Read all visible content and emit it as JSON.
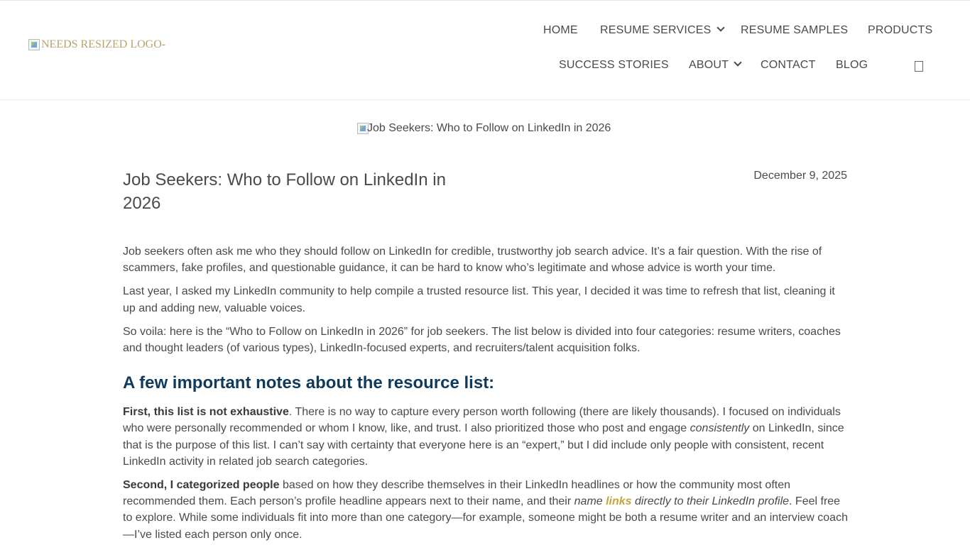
{
  "header": {
    "logo_alt": "NEEDS RESIZED LOGO-",
    "nav": {
      "home": "HOME",
      "resume_services": "RESUME SERVICES",
      "resume_samples": "RESUME SAMPLES",
      "products": "PRODUCTS",
      "success_stories": "SUCCESS STORIES",
      "about": "ABOUT",
      "contact": "CONTACT",
      "blog": "BLOG"
    },
    "icons": {
      "resume_services_dropdown": "chevron-down-icon",
      "about_dropdown": "chevron-down-icon",
      "cart": "cart-icon"
    }
  },
  "hero": {
    "image_alt": "Job Seekers: Who to Follow on LinkedIn in 2026"
  },
  "article": {
    "title": "Job Seekers: Who to Follow on LinkedIn in 2026",
    "date": "December 9, 2025",
    "p1": "Job seekers often ask me who they should follow on LinkedIn for credible, trustworthy job search advice. It’s a fair question. With the rise of scammers, fake profiles, and questionable guidance, it can be hard to know who’s legitimate and whose advice is worth your time.",
    "p2": "Last year, I asked my LinkedIn community to help compile a trusted resource list. This year, I decided it was time to refresh that list, cleaning it up and adding new, valuable voices.",
    "p3": "So voila: here is the “Who to Follow on LinkedIn in 2026” for job seekers. The list below is divided into four categories: resume writers, coaches and thought leaders (of various types), LinkedIn-focused experts, and recruiters/talent acquisition folks.",
    "notes_heading": "A few important notes about the resource list:",
    "note1_lead": "First, this list is not exhaustive",
    "note1_a": ". There is no way to capture every person worth following (there are likely thousands). I focused on individuals who were personally recommended or whom I know, like, and trust. I also prioritized those who post and engage ",
    "note1_em": "consistently",
    "note1_b": " on LinkedIn, since that is the purpose of this list. I can’t say with certainty that everyone here is an “expert,” but I did include only people with consistent, recent LinkedIn activity in related job search categories.",
    "note2_lead": "Second, I categorized people",
    "note2_a": " based on how they describe themselves in their LinkedIn headlines or how the community most often recommended them. Each person’s profile headline appears next to their name, and their ",
    "note2_em1": "name ",
    "note2_link": "links",
    "note2_em2": " directly to their LinkedIn profile",
    "note2_b": ". Feel free to explore. While some individuals fit into more than one category—for example, someone might be both a resume writer and an interview coach—I’ve listed each person only once."
  },
  "colors": {
    "text": "#4a4a4a",
    "heading_navy": "#0f3a5c",
    "link_gold": "#c7a43b",
    "logo_gold": "#b8a46a"
  }
}
